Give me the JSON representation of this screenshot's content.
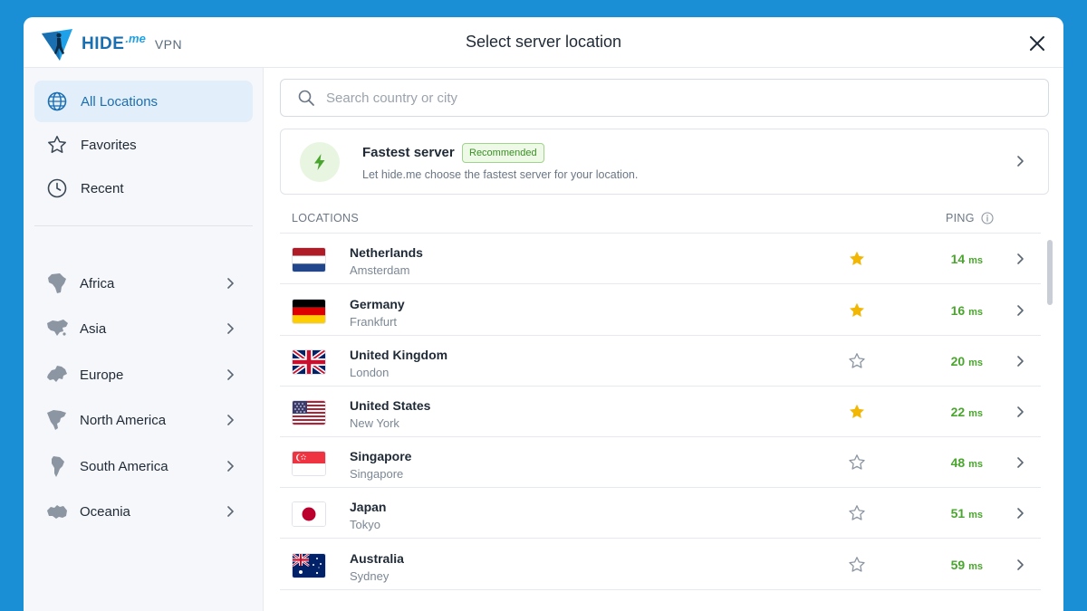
{
  "header": {
    "logo_word": "HIDE",
    "logo_me": ".me",
    "logo_vpn": "VPN",
    "title": "Select server location"
  },
  "sidebar": {
    "items": [
      {
        "label": "All Locations",
        "icon": "globe-icon",
        "active": true
      },
      {
        "label": "Favorites",
        "icon": "star-outline-icon"
      },
      {
        "label": "Recent",
        "icon": "clock-icon"
      }
    ],
    "regions": [
      {
        "label": "Africa",
        "icon": "africa-map-icon"
      },
      {
        "label": "Asia",
        "icon": "asia-map-icon"
      },
      {
        "label": "Europe",
        "icon": "europe-map-icon"
      },
      {
        "label": "North America",
        "icon": "north-america-map-icon"
      },
      {
        "label": "South America",
        "icon": "south-america-map-icon"
      },
      {
        "label": "Oceania",
        "icon": "oceania-map-icon"
      }
    ]
  },
  "search": {
    "placeholder": "Search country or city",
    "value": ""
  },
  "fastest": {
    "title": "Fastest server",
    "badge": "Recommended",
    "subtitle": "Let hide.me choose the fastest server for your location."
  },
  "list": {
    "header_locations": "LOCATIONS",
    "header_ping": "PING",
    "rows": [
      {
        "country": "Netherlands",
        "city": "Amsterdam",
        "favorite": true,
        "ping": "14",
        "unit": "ms",
        "flag": "nl"
      },
      {
        "country": "Germany",
        "city": "Frankfurt",
        "favorite": true,
        "ping": "16",
        "unit": "ms",
        "flag": "de"
      },
      {
        "country": "United Kingdom",
        "city": "London",
        "favorite": false,
        "ping": "20",
        "unit": "ms",
        "flag": "gb"
      },
      {
        "country": "United States",
        "city": "New York",
        "favorite": true,
        "ping": "22",
        "unit": "ms",
        "flag": "us"
      },
      {
        "country": "Singapore",
        "city": "Singapore",
        "favorite": false,
        "ping": "48",
        "unit": "ms",
        "flag": "sg"
      },
      {
        "country": "Japan",
        "city": "Tokyo",
        "favorite": false,
        "ping": "51",
        "unit": "ms",
        "flag": "jp"
      },
      {
        "country": "Australia",
        "city": "Sydney",
        "favorite": false,
        "ping": "59",
        "unit": "ms",
        "flag": "au"
      }
    ]
  },
  "colors": {
    "background": "#1a8fd6",
    "accent": "#1a6fb0",
    "ping_green": "#4aa52e",
    "star_gold": "#f2b705",
    "active_bg": "#e3eefb"
  }
}
